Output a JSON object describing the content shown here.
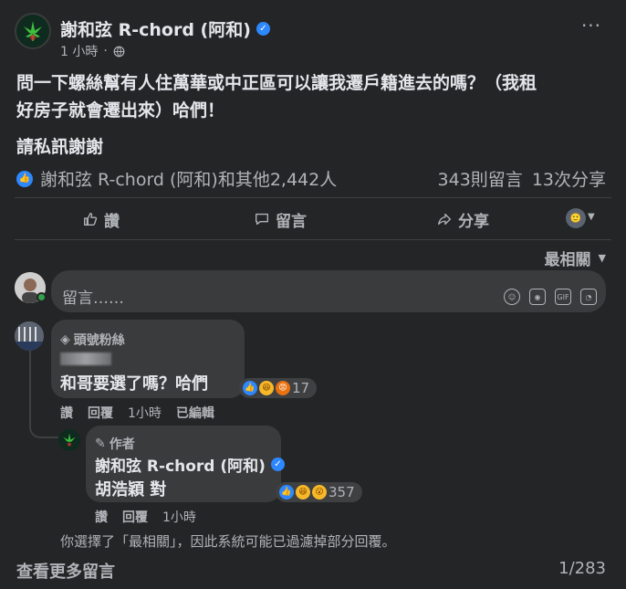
{
  "post": {
    "author": "謝和弦 R-chord (阿和)",
    "time": "1 小時",
    "text_line1": "問一下螺絲幫有人住萬華或中正區可以讓我遷戶籍進去的嗎？（我租",
    "text_line2": "好房子就會遷出來）哈們！",
    "text_line3": "請私訊謝謝",
    "reaction_summary": "謝和弦 R-chord (阿和)和其他2,442人",
    "comment_count": "343則留言",
    "share_count": "13次分享"
  },
  "actions": {
    "like": "讚",
    "comment": "留言",
    "share": "分享"
  },
  "sort_label": "最相關",
  "composer": {
    "placeholder": "留言……",
    "gif": "GIF"
  },
  "comment1": {
    "badge": "頭號粉絲",
    "text": "和哥要選了嗎？哈們",
    "reaction_count": "17",
    "like": "讚",
    "reply": "回覆",
    "time": "1小時",
    "edited": "已編輯"
  },
  "reply1": {
    "badge": "作者",
    "author": "謝和弦 R-chord (阿和)",
    "text": "胡浩穎 對",
    "reaction_count": "357",
    "like": "讚",
    "reply": "回覆",
    "time": "1小時"
  },
  "notice": "你選擇了「最相關」，因此系統可能已過濾掉部分回覆。",
  "more_comments": "查看更多留言",
  "pager": "1/283",
  "colors": {
    "background": "#242526",
    "bubble": "#3a3b3c",
    "primary_text": "#e4e6eb",
    "secondary_text": "#b0b3b8",
    "like_blue": "#2d88ff",
    "online_green": "#31a24c"
  }
}
